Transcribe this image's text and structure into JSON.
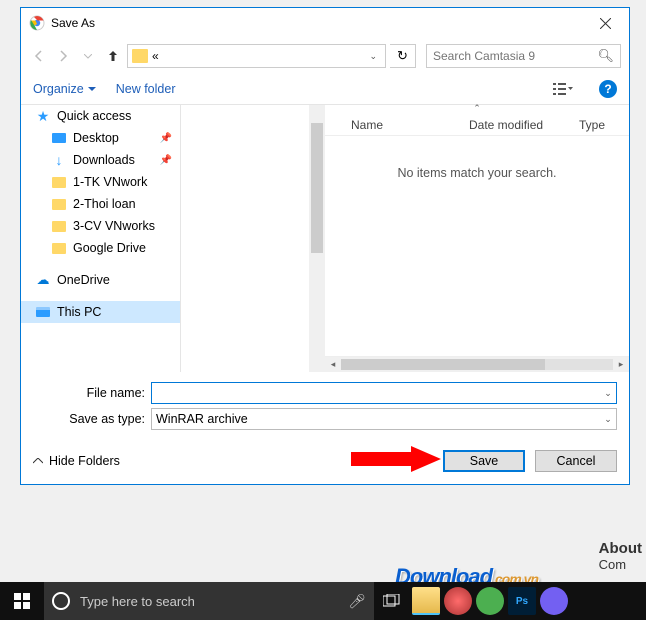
{
  "window": {
    "title": "Save As"
  },
  "nav": {
    "path_display": "«"
  },
  "search": {
    "placeholder": "Search Camtasia 9"
  },
  "toolbar": {
    "organize": "Organize",
    "new_folder": "New folder"
  },
  "tree": {
    "quick_access": "Quick access",
    "items": [
      {
        "label": "Desktop",
        "pinned": true
      },
      {
        "label": "Downloads",
        "pinned": true
      },
      {
        "label": "1-TK VNwork",
        "pinned": false
      },
      {
        "label": "2-Thoi loan",
        "pinned": false
      },
      {
        "label": "3-CV VNworks",
        "pinned": false
      },
      {
        "label": "Google Drive",
        "pinned": false
      }
    ],
    "onedrive": "OneDrive",
    "this_pc": "This PC"
  },
  "columns": {
    "name": "Name",
    "date": "Date modified",
    "type": "Type"
  },
  "file_list": {
    "empty_message": "No items match your search."
  },
  "form": {
    "filename_label": "File name:",
    "filename_value": "",
    "savetype_label": "Save as type:",
    "savetype_value": "WinRAR archive"
  },
  "buttons": {
    "hide_folders": "Hide Folders",
    "save": "Save",
    "cancel": "Cancel"
  },
  "taskbar": {
    "search_placeholder": "Type here to search"
  },
  "about": {
    "heading": "About",
    "sub": "Com"
  },
  "logo": {
    "main": "Download",
    "ext": ".com.vn"
  }
}
